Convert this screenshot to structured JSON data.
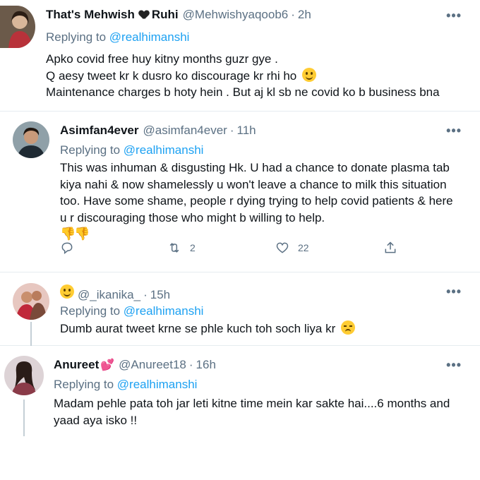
{
  "tweets": [
    {
      "name": "That's Mehwish",
      "name_suffix": "Ruhi",
      "handle": "@Mehwishyaqoob6",
      "time": "2h",
      "replying_prefix": "Replying to",
      "replying_to": "@realhimanshi",
      "lines": [
        "Apko covid free huy kitny months guzr gye .",
        "Q aesy tweet kr k dusro ko discourage kr rhi ho",
        "Maintenance charges b hoty  hein . But aj kl sb  ne covid ko b business  bna"
      ]
    },
    {
      "name": "Asimfan4ever",
      "handle": "@asimfan4ever",
      "time": "11h",
      "replying_prefix": "Replying to",
      "replying_to": "@realhimanshi",
      "lines": [
        "This was inhuman & disgusting Hk. U had a chance to donate plasma tab",
        "kiya nahi & now shamelessly u won't leave a chance to milk this situation",
        "too. Have some shame, people r dying trying to help covid patients & here",
        "u r discouraging those who might b willing to help."
      ],
      "emoji_line": "👎👎",
      "retweets": "2",
      "likes": "22"
    },
    {
      "name": "",
      "handle": "@_ikanika_",
      "time": "15h",
      "replying_prefix": "Replying to",
      "replying_to": "@realhimanshi",
      "lines": [
        "Dumb aurat tweet krne se phle kuch toh soch liya kr"
      ]
    },
    {
      "name": "Anureet",
      "handle": "@Anureet18",
      "time": "16h",
      "replying_prefix": "Replying to",
      "replying_to": "@realhimanshi",
      "lines": [
        "Madam pehle pata toh jar leti kitne time mein kar sakte hai....6 months and",
        "yaad aya isko !!"
      ]
    }
  ],
  "more_label": "•••",
  "dot": "·",
  "colors": {
    "text": "#0f1419",
    "secondary": "#5b7083",
    "link": "#1da1f2",
    "divider": "#e6ecf0"
  }
}
